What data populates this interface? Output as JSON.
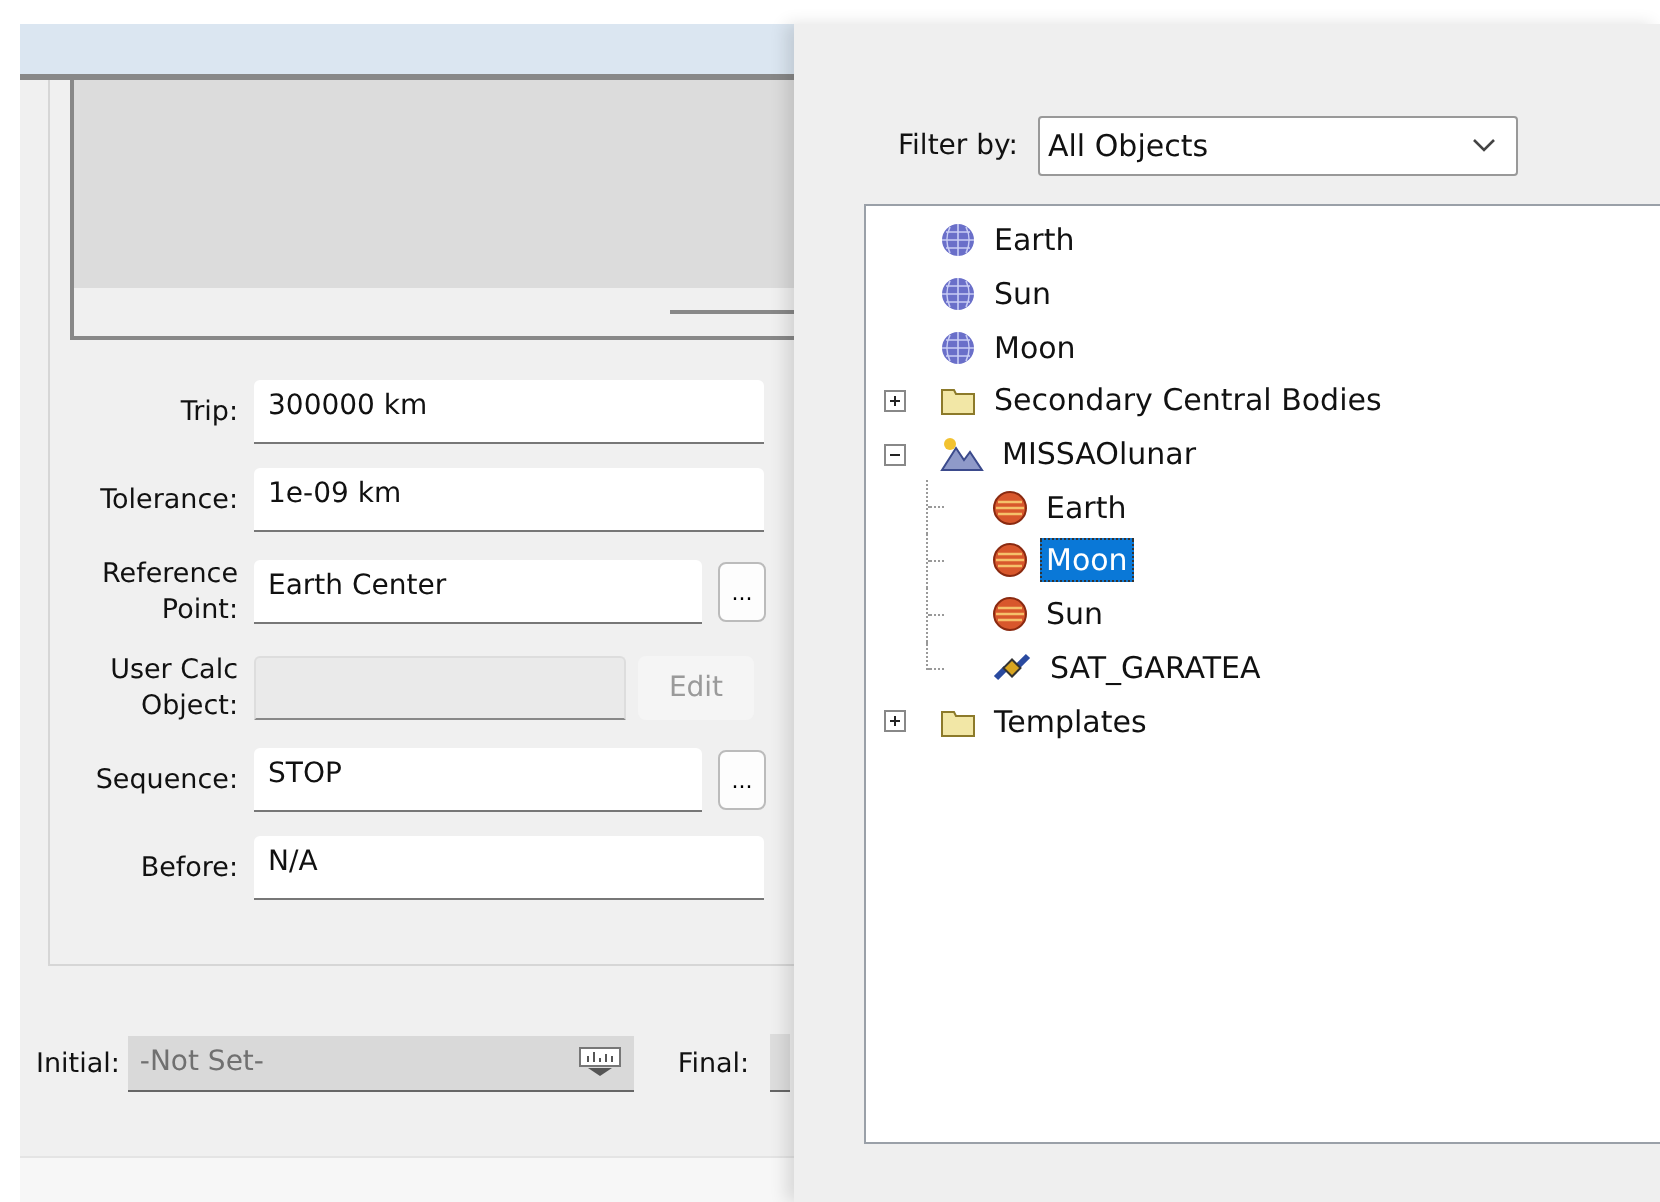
{
  "form": {
    "rows": [
      {
        "label": "Trip:",
        "value": "300000 km",
        "kind": "text",
        "disabled": false
      },
      {
        "label": "Tolerance:",
        "value": "1e-09 km",
        "kind": "text",
        "disabled": false
      },
      {
        "label": "Reference Point:",
        "value": "Earth Center",
        "kind": "browse",
        "disabled": false,
        "button": "..."
      },
      {
        "label": "User Calc Object:",
        "value": "",
        "kind": "edit",
        "disabled": true,
        "button": "Edit"
      },
      {
        "label": "Sequence:",
        "value": "STOP",
        "kind": "browse",
        "disabled": false,
        "button": "..."
      },
      {
        "label": "Before:",
        "value": "N/A",
        "kind": "text",
        "disabled": false
      }
    ]
  },
  "bottom": {
    "initial_label": "Initial:",
    "initial_value": "-Not Set-",
    "initial_disabled": true,
    "final_label": "Final:"
  },
  "filter": {
    "label": "Filter by:",
    "value": "All Objects"
  },
  "tree": [
    {
      "label": "Earth",
      "kind": "planet",
      "selected": false
    },
    {
      "label": "Sun",
      "kind": "planet",
      "selected": false
    },
    {
      "label": "Moon",
      "kind": "planet",
      "selected": false
    },
    {
      "label": "Secondary Central Bodies",
      "kind": "folder",
      "expanded": false,
      "selected": false
    },
    {
      "label": "MISSAOlunar",
      "kind": "scenario",
      "expanded": true,
      "selected": false,
      "children": [
        {
          "label": "Earth",
          "kind": "body",
          "selected": false
        },
        {
          "label": "Moon",
          "kind": "body",
          "selected": true
        },
        {
          "label": "Sun",
          "kind": "body",
          "selected": false
        },
        {
          "label": "SAT_GARATEA",
          "kind": "satellite",
          "selected": false
        }
      ]
    },
    {
      "label": "Templates",
      "kind": "folder",
      "expanded": false,
      "selected": false
    }
  ]
}
